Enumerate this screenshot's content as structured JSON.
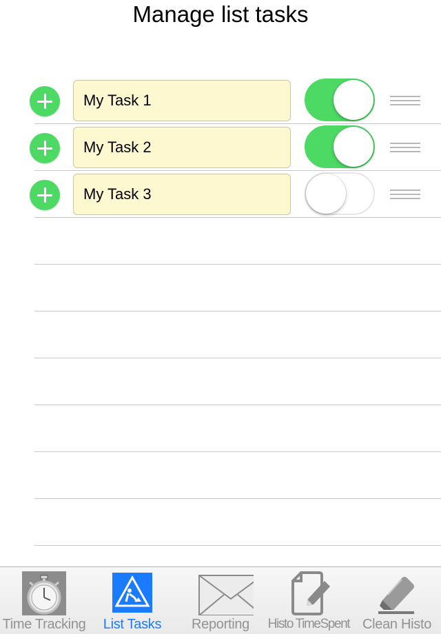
{
  "header": {
    "title": "Manage list tasks"
  },
  "tasks": [
    {
      "name": "My Task 1",
      "enabled": true
    },
    {
      "name": "My Task 2",
      "enabled": true
    },
    {
      "name": "My Task 3",
      "enabled": false
    }
  ],
  "tabbar": {
    "selected": "List Tasks",
    "tabs": [
      {
        "label": "Time Tracking",
        "icon": "stopwatch-icon"
      },
      {
        "label": "List Tasks",
        "icon": "roadwork-sign-icon"
      },
      {
        "label": "Reporting",
        "icon": "envelope-icon"
      },
      {
        "label": "Histo TimeSpent",
        "icon": "edit-document-icon"
      },
      {
        "label": "Clean Histo",
        "icon": "eraser-icon"
      }
    ]
  },
  "colors": {
    "accent_green": "#4cd964",
    "selected_blue": "#1b7bff",
    "task_field_bg": "#fdf8cf",
    "inactive_gray": "#929292"
  }
}
